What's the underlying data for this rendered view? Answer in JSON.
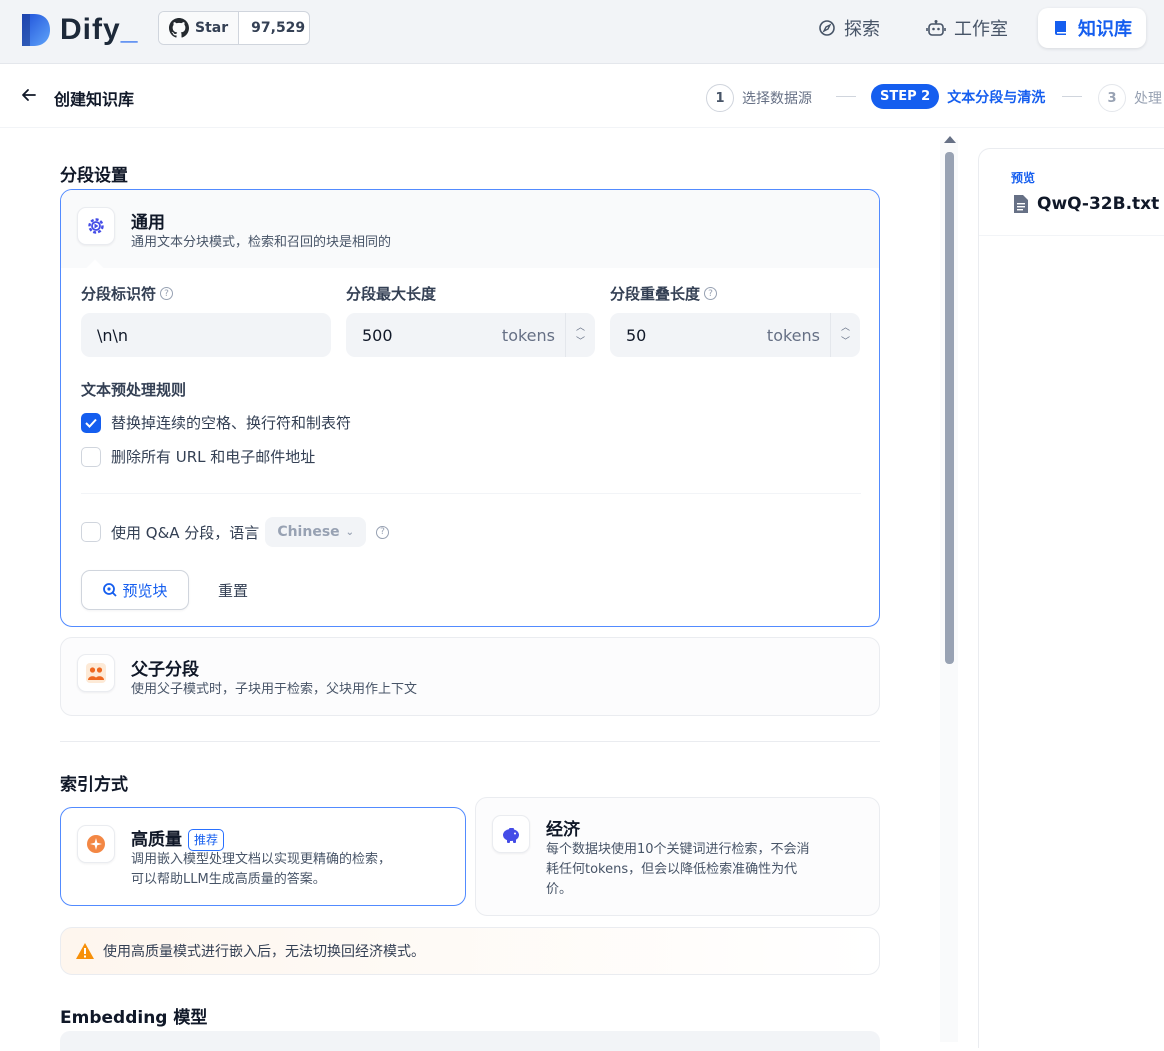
{
  "brand": {
    "name": "Dify",
    "cursor": "_"
  },
  "github": {
    "star_label": "Star",
    "count": "97,529"
  },
  "nav": [
    {
      "label": "探索",
      "icon": "compass-icon"
    },
    {
      "label": "工作室",
      "icon": "robot-icon"
    },
    {
      "label": "知识库",
      "icon": "book-icon",
      "active": true
    }
  ],
  "header": {
    "back_icon": "arrow-left-icon",
    "title": "创建知识库"
  },
  "steps": [
    {
      "num": "1",
      "label": "选择数据源"
    },
    {
      "pill": "STEP 2",
      "label": "文本分段与清洗"
    },
    {
      "num": "3",
      "label": "处理"
    }
  ],
  "segment": {
    "title": "分段设置",
    "general": {
      "title": "通用",
      "desc": "通用文本分块模式，检索和召回的块是相同的"
    },
    "fields": {
      "delimiter_label": "分段标识符",
      "delimiter_value": "\\n\\n",
      "max_label": "分段最大长度",
      "max_value": "500",
      "overlap_label": "分段重叠长度",
      "overlap_value": "50",
      "unit": "tokens"
    },
    "rules_title": "文本预处理规则",
    "rule1": "替换掉连续的空格、换行符和制表符",
    "rule2": "删除所有 URL 和电子邮件地址",
    "qa_label": "使用 Q&A 分段，语言",
    "qa_lang": "Chinese",
    "preview_btn": "预览块",
    "reset_btn": "重置",
    "parent": {
      "title": "父子分段",
      "desc": "使用父子模式时，子块用于检索，父块用作上下文"
    }
  },
  "index": {
    "title": "索引方式",
    "hq": {
      "title": "高质量",
      "badge": "推荐",
      "desc1": "调用嵌入模型处理文档以实现更精确的检索，",
      "desc2": "可以帮助LLM生成高质量的答案。"
    },
    "eco": {
      "title": "经济",
      "desc1": "每个数据块使用10个关键词进行检索，不会消",
      "desc2": "耗任何tokens，但会以降低检索准确性为代",
      "desc3": "价。"
    },
    "warning": "使用高质量模式进行嵌入后，无法切换回经济模式。"
  },
  "embedding": {
    "title": "Embedding 模型"
  },
  "preview": {
    "label": "预览",
    "file": "QwQ-32B.txt"
  },
  "colors": {
    "accent": "#155eef",
    "warning": "#f79009"
  }
}
